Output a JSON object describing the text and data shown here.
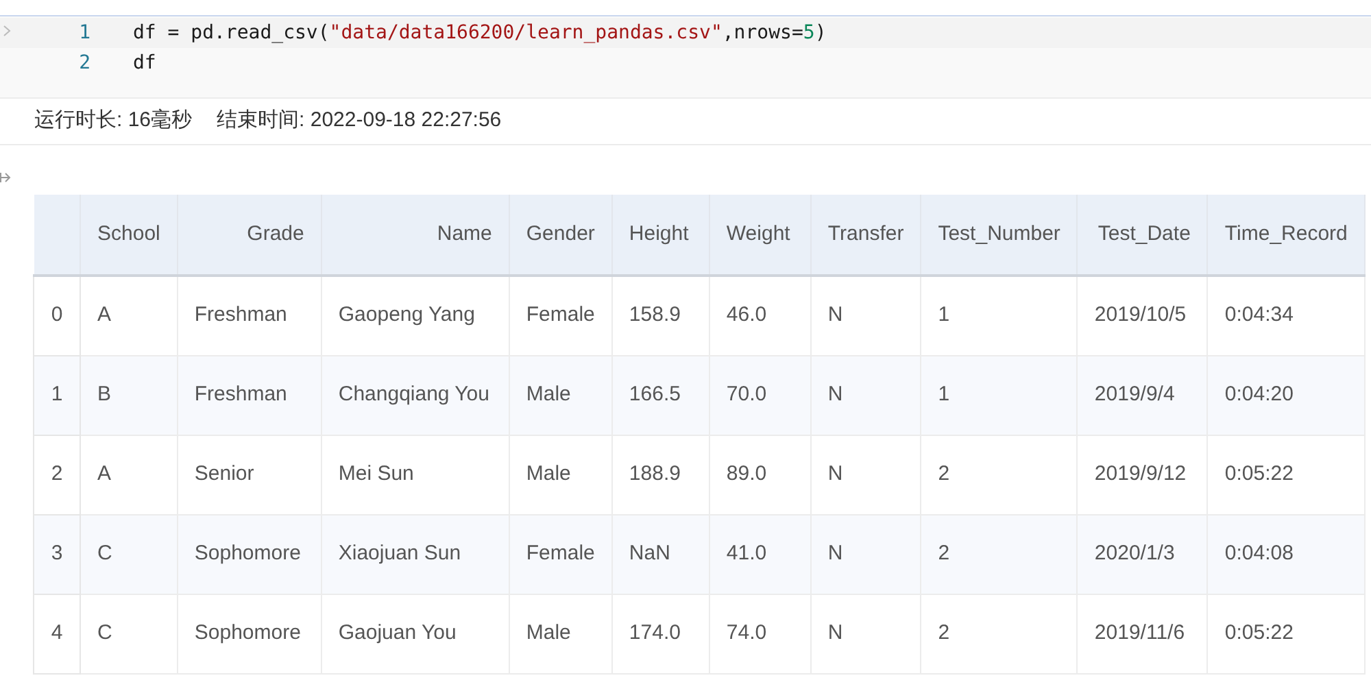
{
  "code_cell": {
    "lines": [
      {
        "number": "1",
        "tokens": [
          {
            "kind": "plain",
            "text": "df = pd.read_csv("
          },
          {
            "kind": "string",
            "text": "\"data/data166200/learn_pandas.csv\""
          },
          {
            "kind": "plain",
            "text": ",nrows="
          },
          {
            "kind": "number",
            "text": "5"
          },
          {
            "kind": "plain",
            "text": ")"
          }
        ]
      },
      {
        "number": "2",
        "tokens": [
          {
            "kind": "plain",
            "text": "df"
          }
        ]
      }
    ]
  },
  "run_info": {
    "duration": "运行时长: 16毫秒",
    "end_time": "结束时间: 2022-09-18 22:27:56"
  },
  "table": {
    "columns": [
      {
        "label": "School"
      },
      {
        "label": "Grade"
      },
      {
        "label": "Name"
      },
      {
        "label": "Gender"
      },
      {
        "label": "Height"
      },
      {
        "label": "Weight"
      },
      {
        "label": "Transfer"
      },
      {
        "label": "Test_Number"
      },
      {
        "label": "Test_Date"
      },
      {
        "label": "Time_Record"
      }
    ],
    "rows": [
      {
        "index": "0",
        "cells": [
          "A",
          "Freshman",
          "Gaopeng Yang",
          "Female",
          "158.9",
          "46.0",
          "N",
          "1",
          "2019/10/5",
          "0:04:34"
        ]
      },
      {
        "index": "1",
        "cells": [
          "B",
          "Freshman",
          "Changqiang You",
          "Male",
          "166.5",
          "70.0",
          "N",
          "1",
          "2019/9/4",
          "0:04:20"
        ]
      },
      {
        "index": "2",
        "cells": [
          "A",
          "Senior",
          "Mei Sun",
          "Male",
          "188.9",
          "89.0",
          "N",
          "2",
          "2019/9/12",
          "0:05:22"
        ]
      },
      {
        "index": "3",
        "cells": [
          "C",
          "Sophomore",
          "Xiaojuan Sun",
          "Female",
          "NaN",
          "41.0",
          "N",
          "2",
          "2020/1/3",
          "0:04:08"
        ]
      },
      {
        "index": "4",
        "cells": [
          "C",
          "Sophomore",
          "Gaojuan You",
          "Male",
          "174.0",
          "74.0",
          "N",
          "2",
          "2019/11/6",
          "0:05:22"
        ]
      }
    ]
  }
}
